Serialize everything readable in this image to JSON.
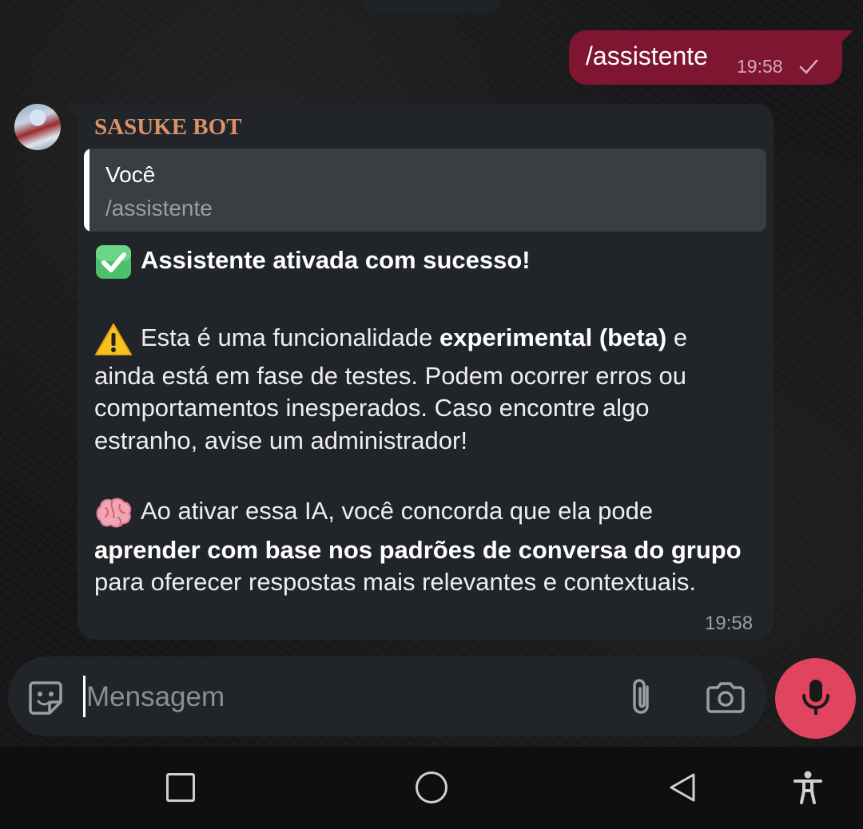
{
  "outgoing": {
    "text": "/assistente",
    "time": "19:58"
  },
  "incoming": {
    "sender": "SASUKE BOT",
    "reply": {
      "author": "Você",
      "text": "/assistente"
    },
    "line1_bold": "Assistente ativada com sucesso!",
    "p2_l1_pre": "Esta é uma funcionalidade ",
    "p2_l1_bold": "experimental (beta)",
    "p2_l1_post": " e",
    "p2_l2": "ainda está em fase de testes. Podem ocorrer erros ou",
    "p2_l3": "comportamentos inesperados. Caso encontre algo",
    "p2_l4": "estranho, avise um administrador!",
    "p3_l1": "Ao ativar essa IA, você concorda que ela pode",
    "p3_l2_bold": "aprender com base nos padrões de conversa do grupo",
    "p3_l3": "para oferecer respostas mais relevantes e contextuais.",
    "time": "19:58"
  },
  "composer": {
    "placeholder": "Mensagem"
  },
  "icons": {
    "check": "check-icon",
    "success": "check-mark-button-emoji",
    "warning": "warning-emoji",
    "brain": "brain-emoji",
    "sticker": "sticker-icon",
    "attach": "paperclip-icon",
    "camera": "camera-icon",
    "mic": "microphone-icon"
  },
  "colors": {
    "outgoing_bubble": "#7e1631",
    "incoming_bubble": "#212529",
    "sender_name": "#d9926a",
    "mic_button": "#e0445f"
  }
}
